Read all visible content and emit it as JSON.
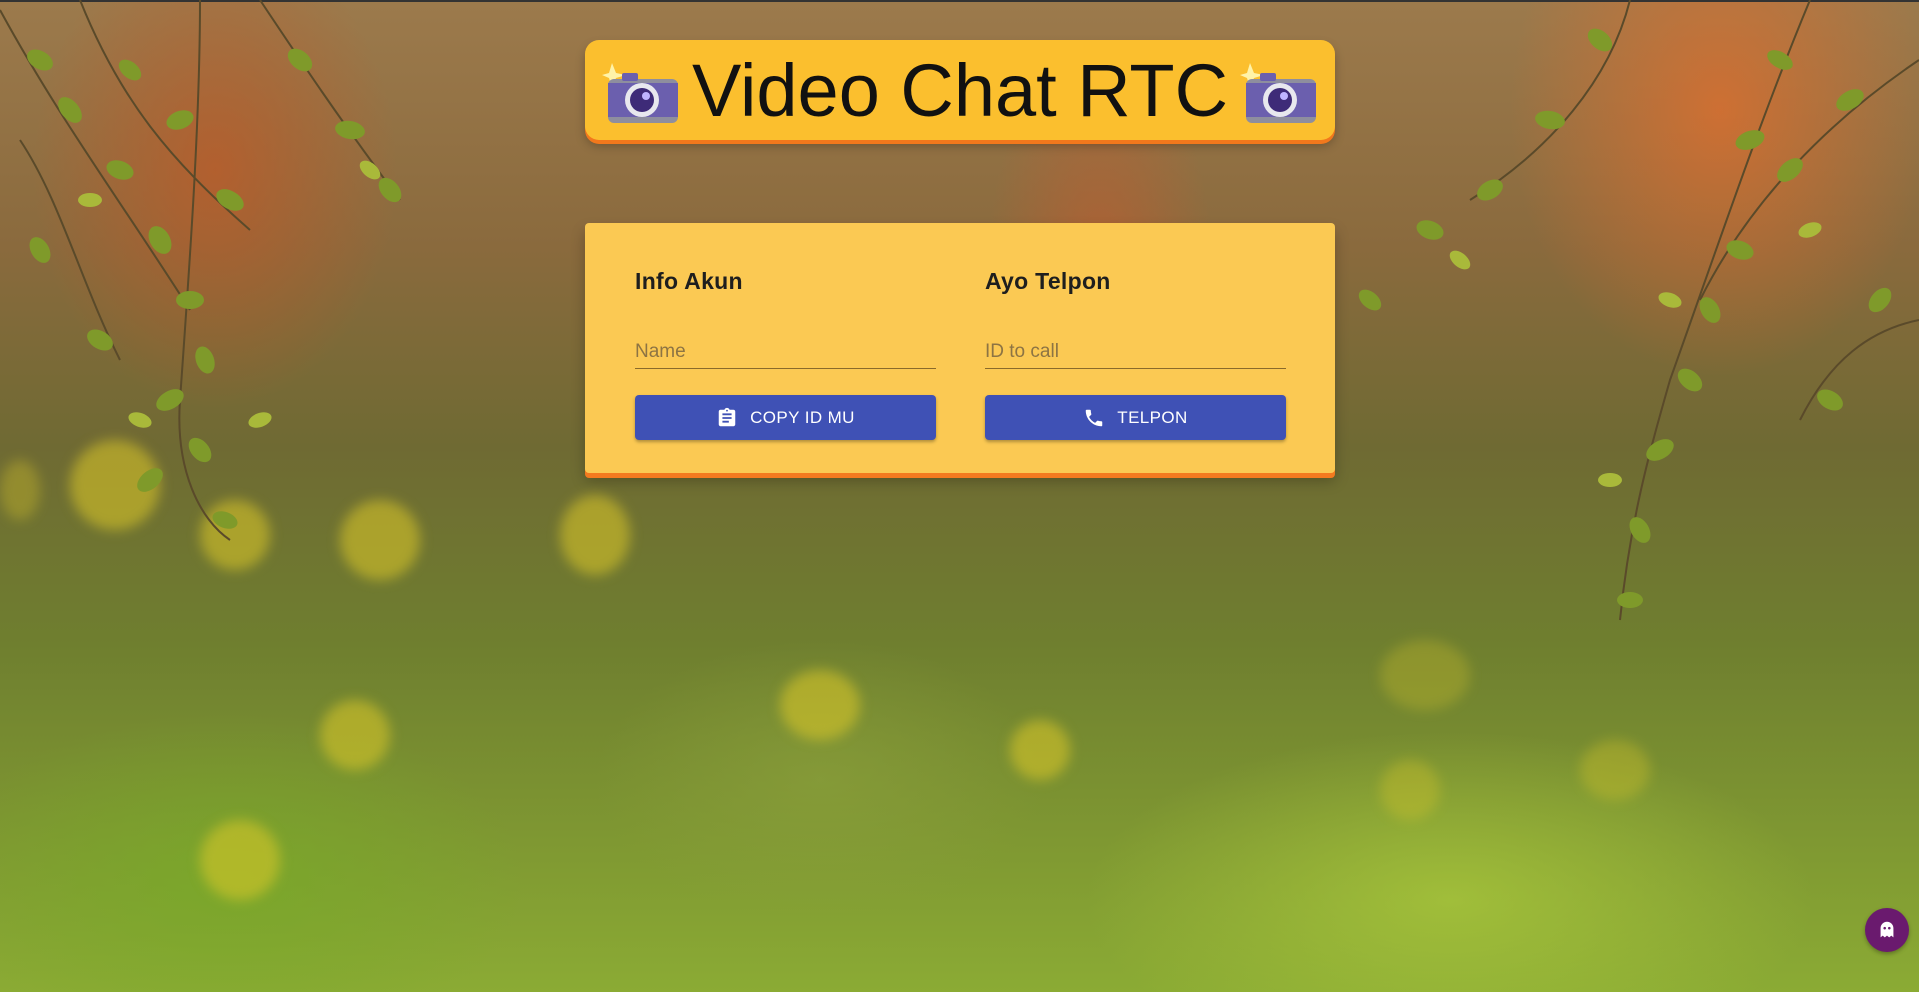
{
  "header": {
    "title": "Video Chat RTC",
    "left_icon": "camera-with-flash-icon",
    "right_icon": "camera-with-flash-icon"
  },
  "account": {
    "heading": "Info Akun",
    "name_placeholder": "Name",
    "name_value": "",
    "copy_button_label": "COPY ID MU",
    "copy_button_icon": "clipboard-icon"
  },
  "call": {
    "heading": "Ayo Telpon",
    "id_placeholder": "ID to call",
    "id_value": "",
    "call_button_label": "TELPON",
    "call_button_icon": "phone-icon"
  },
  "floating": {
    "icon": "ghost-icon"
  },
  "colors": {
    "title_bg": "#fbbf2e",
    "card_bg": "#fbc953",
    "accent_shadow": "#f47a1f",
    "button_bg": "#3f51b5",
    "floating_bg": "#6a1a6e"
  }
}
